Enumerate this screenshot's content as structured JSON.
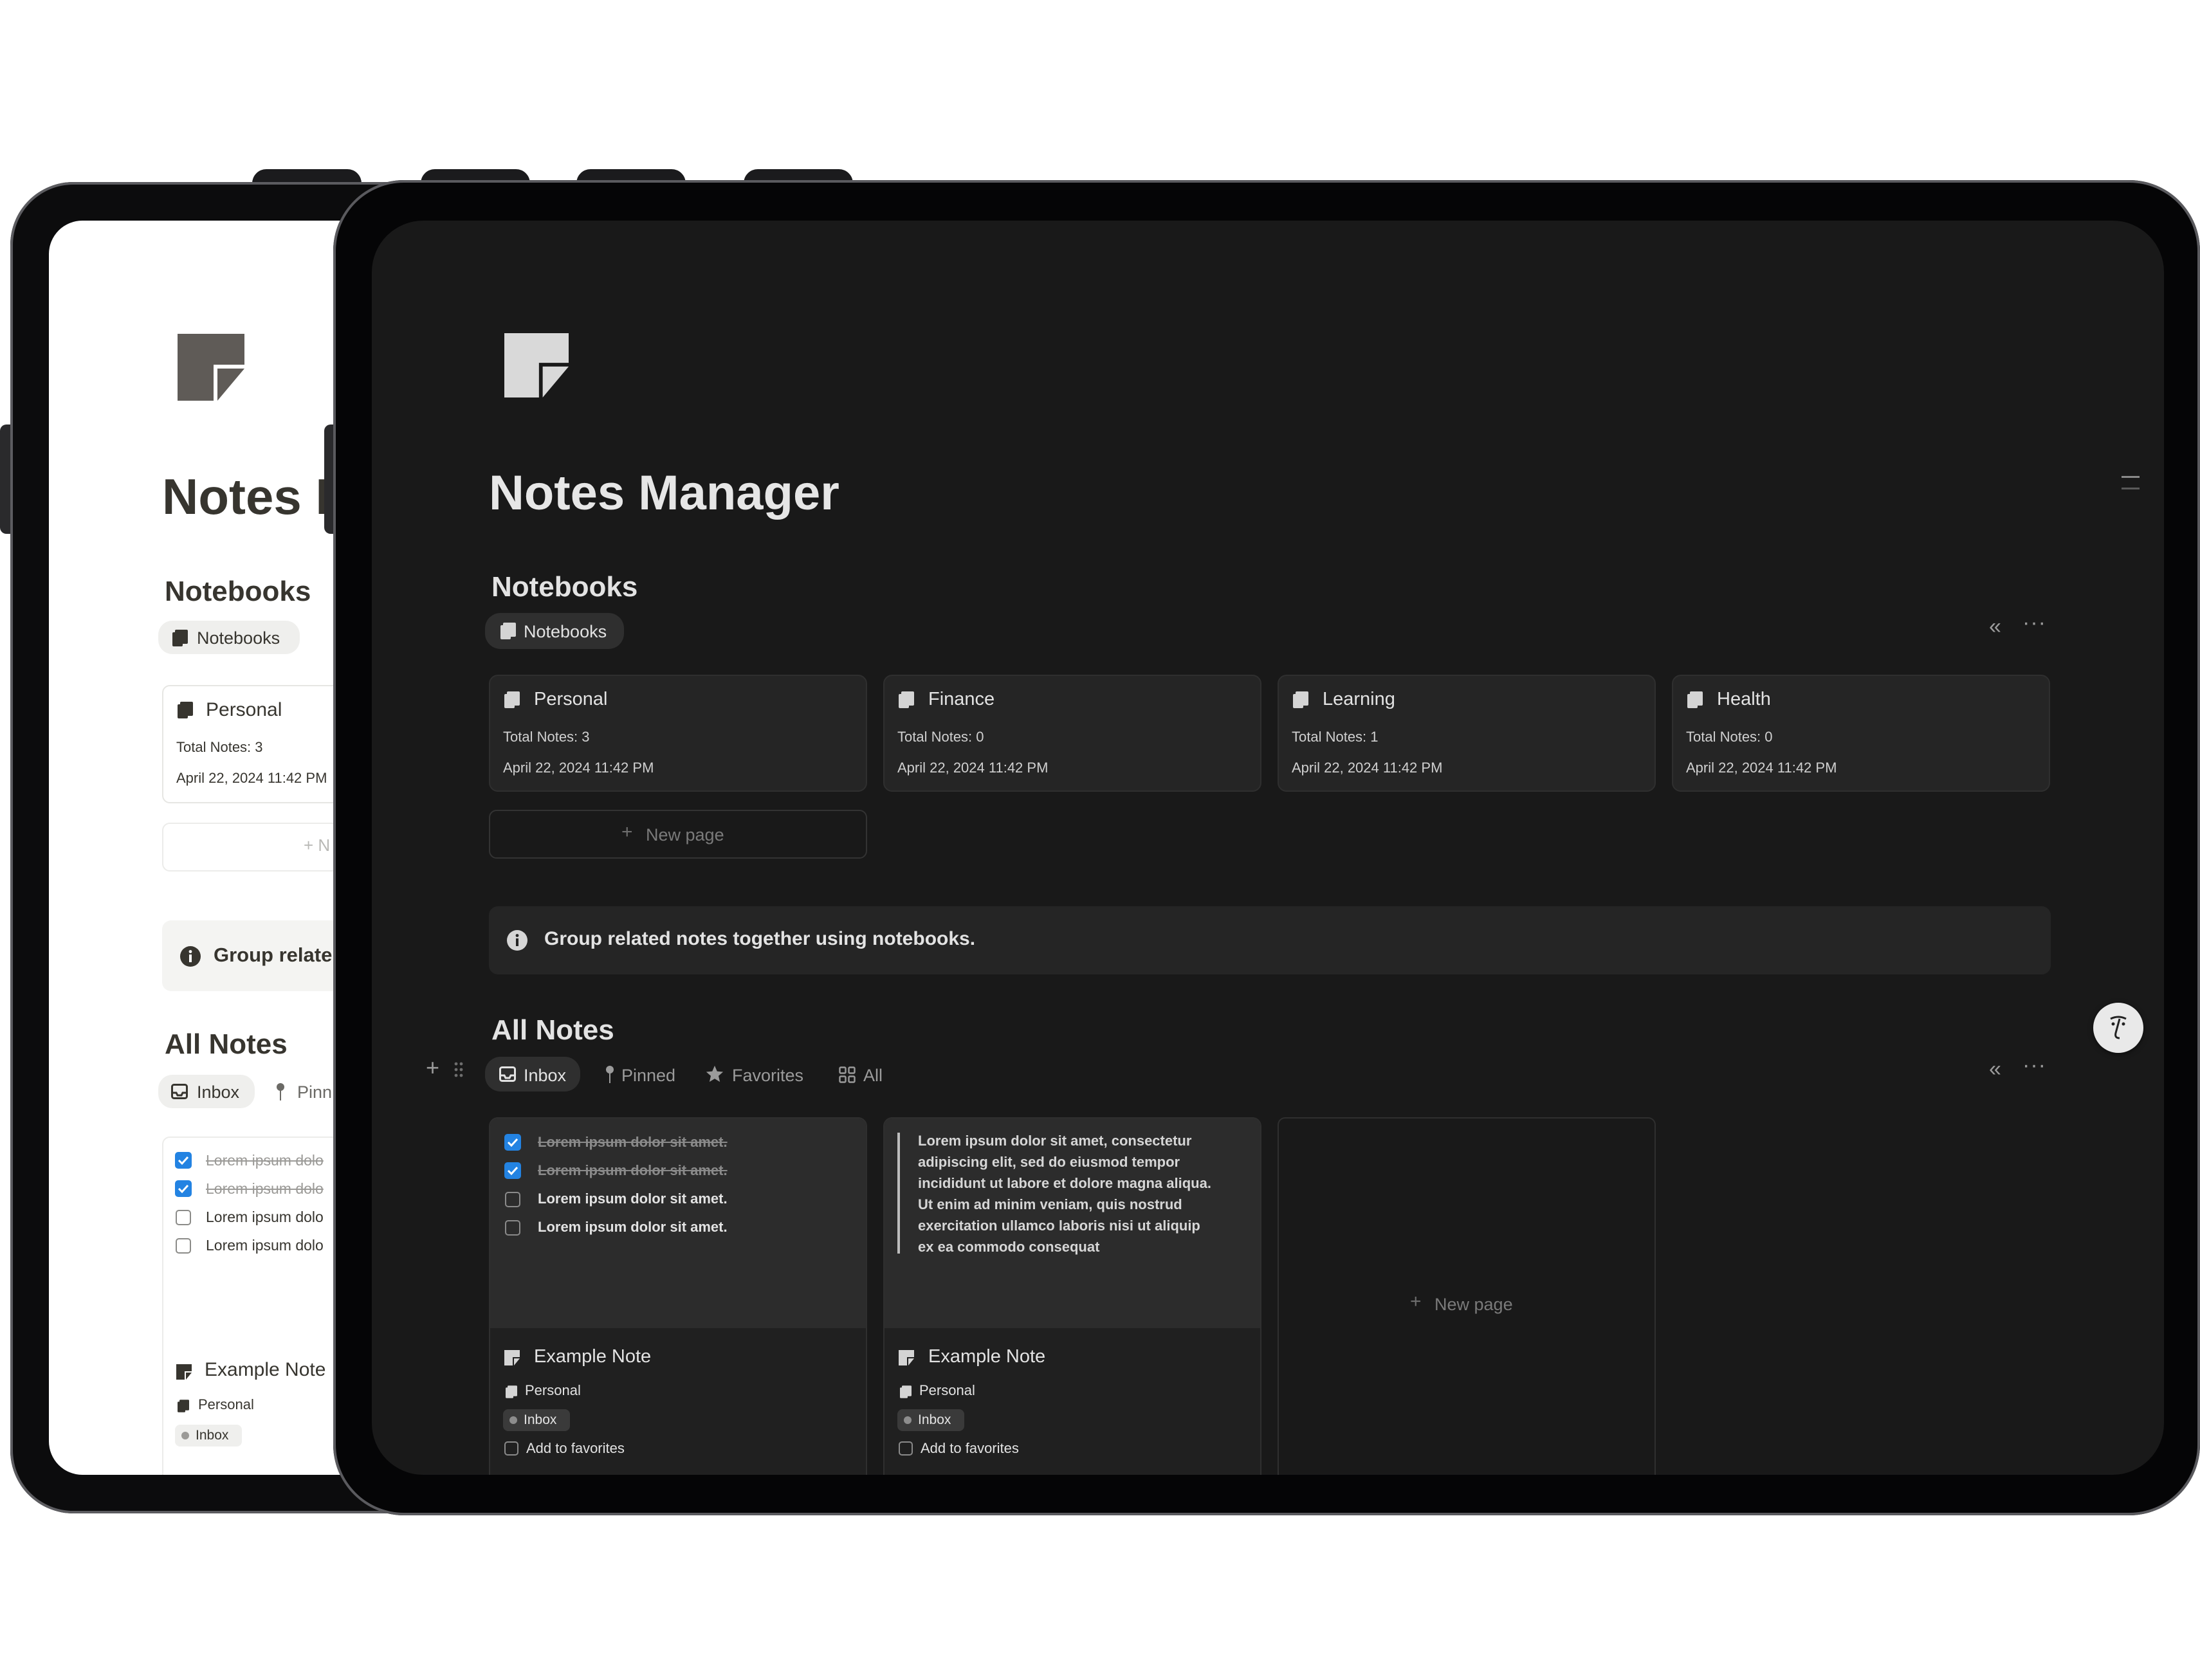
{
  "app": {
    "title": "Notes Manager"
  },
  "notebooks": {
    "heading": "Notebooks",
    "view_tab": "Notebooks",
    "items": [
      {
        "name": "Personal",
        "total_notes": "Total Notes: 3",
        "date": "April 22, 2024 11:42 PM"
      },
      {
        "name": "Finance",
        "total_notes": "Total Notes: 0",
        "date": "April 22, 2024 11:42 PM"
      },
      {
        "name": "Learning",
        "total_notes": "Total Notes: 1",
        "date": "April 22, 2024 11:42 PM"
      },
      {
        "name": "Health",
        "total_notes": "Total Notes: 0",
        "date": "April 22, 2024 11:42 PM"
      }
    ],
    "new_page": "New page"
  },
  "callout": {
    "text": "Group related notes together using notebooks."
  },
  "all_notes": {
    "heading": "All Notes",
    "tabs": [
      "Inbox",
      "Pinned",
      "Favorites",
      "All"
    ],
    "notes": [
      {
        "title": "Example Note",
        "checklist": [
          {
            "text": "Lorem ipsum dolor sit amet.",
            "checked": true
          },
          {
            "text": "Lorem ipsum dolor sit amet.",
            "checked": true
          },
          {
            "text": "Lorem ipsum dolor sit amet.",
            "checked": false
          },
          {
            "text": "Lorem ipsum dolor sit amet.",
            "checked": false
          }
        ],
        "notebook": "Personal",
        "status": "Inbox",
        "favorite_label": "Add to favorites"
      },
      {
        "title": "Example Note",
        "quote_lines": [
          "Lorem ipsum dolor sit amet, consectetur",
          "adipiscing elit, sed do eiusmod tempor",
          "incididunt ut labore et dolore magna aliqua.",
          "Ut enim ad minim veniam, quis nostrud",
          "exercitation ullamco laboris nisi ut aliquip",
          "ex ea commodo consequat"
        ],
        "notebook": "Personal",
        "status": "Inbox",
        "favorite_label": "Add to favorites"
      }
    ],
    "new_page": "New page"
  },
  "light_preview": {
    "title_partial": "Notes M",
    "notebooks_heading": "Notebooks",
    "view_tab": "Notebooks",
    "card": {
      "name": "Personal",
      "total_notes": "Total Notes: 3",
      "date": "April 22, 2024 11:42 PM"
    },
    "new_page_partial": "+ N",
    "callout_partial": "Group relate",
    "all_notes_heading": "All Notes",
    "tab_inbox": "Inbox",
    "tab_pinned_partial": "Pinn",
    "check_items": [
      {
        "text": "Lorem ipsum dolo",
        "checked": true
      },
      {
        "text": "Lorem ipsum dolo",
        "checked": true
      },
      {
        "text": "Lorem ipsum dolo",
        "checked": false
      },
      {
        "text": "Lorem ipsum dolo",
        "checked": false
      }
    ],
    "note_title": "Example Note",
    "note_notebook": "Personal",
    "note_status": "Inbox"
  },
  "icons": {
    "logo": "notes-logo-icon",
    "book": "book-icon",
    "note": "note-icon",
    "info": "info-icon",
    "inbox": "inbox-icon",
    "pin": "pin-icon",
    "star": "star-icon",
    "grid": "grid-icon",
    "chevrons": "double-chevron-left-icon",
    "more": "more-horizontal-icon",
    "plus": "plus-icon",
    "drag": "drag-handle-icon",
    "assistant": "assistant-face-icon"
  },
  "colors": {
    "dark_bg": "#191919",
    "card_bg": "#252525",
    "accent_blue": "#2383e2",
    "light_bg": "#ffffff"
  }
}
